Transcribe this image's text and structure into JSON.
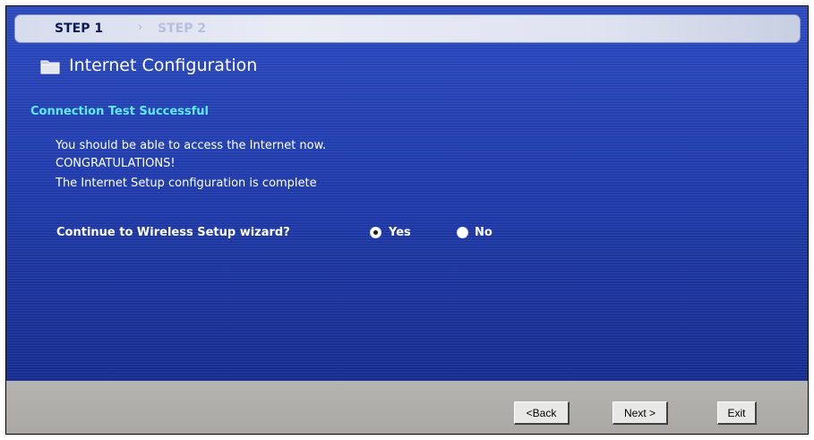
{
  "steps": {
    "current": "STEP 1",
    "separator": "›",
    "next": "STEP 2"
  },
  "header": {
    "icon": "folder-icon",
    "title": "Internet Configuration"
  },
  "status": {
    "heading": "Connection Test Successful",
    "lines": [
      "You should be able to access the Internet now.",
      "CONGRATULATIONS!",
      "The Internet Setup configuration is complete"
    ]
  },
  "wizard": {
    "question": "Continue to Wireless Setup wizard?",
    "options": [
      {
        "label": "Yes",
        "selected": true
      },
      {
        "label": "No",
        "selected": false
      }
    ]
  },
  "footer": {
    "back": "<Back",
    "next": "Next >",
    "exit": "Exit"
  },
  "colors": {
    "panel": "#1c35a0",
    "heading_accent": "#5fe9ff",
    "footer": "#b0aeab"
  }
}
